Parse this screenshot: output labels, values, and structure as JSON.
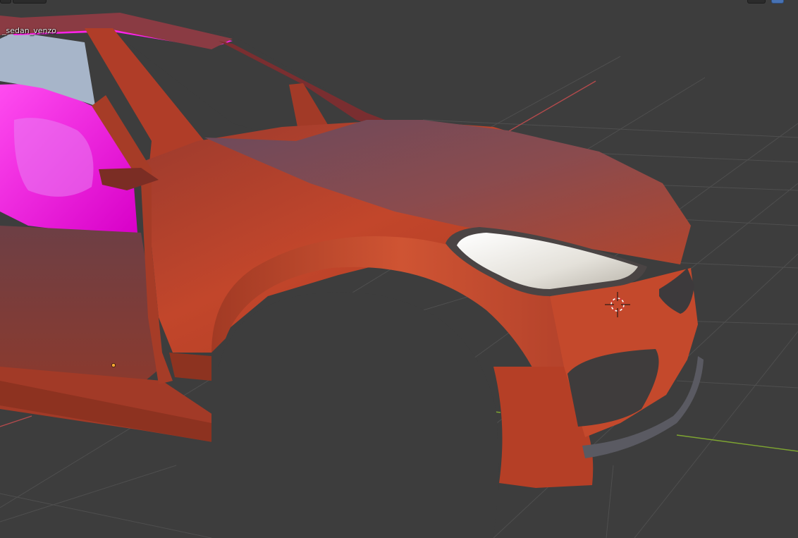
{
  "viewport": {
    "object_name": "_sedan_venzo",
    "background_color": "#3d3d3d",
    "grid_color": "#4e4e4e",
    "x_axis_color": "#c7484b",
    "y_axis_color": "#7ea531",
    "car_body_color": "#b5402a",
    "missing_texture_color": "#ff1fe6",
    "headlight_color": "#ece9e2",
    "cursor_icon": "3d-cursor-icon",
    "origin_icon": "object-origin-icon"
  }
}
